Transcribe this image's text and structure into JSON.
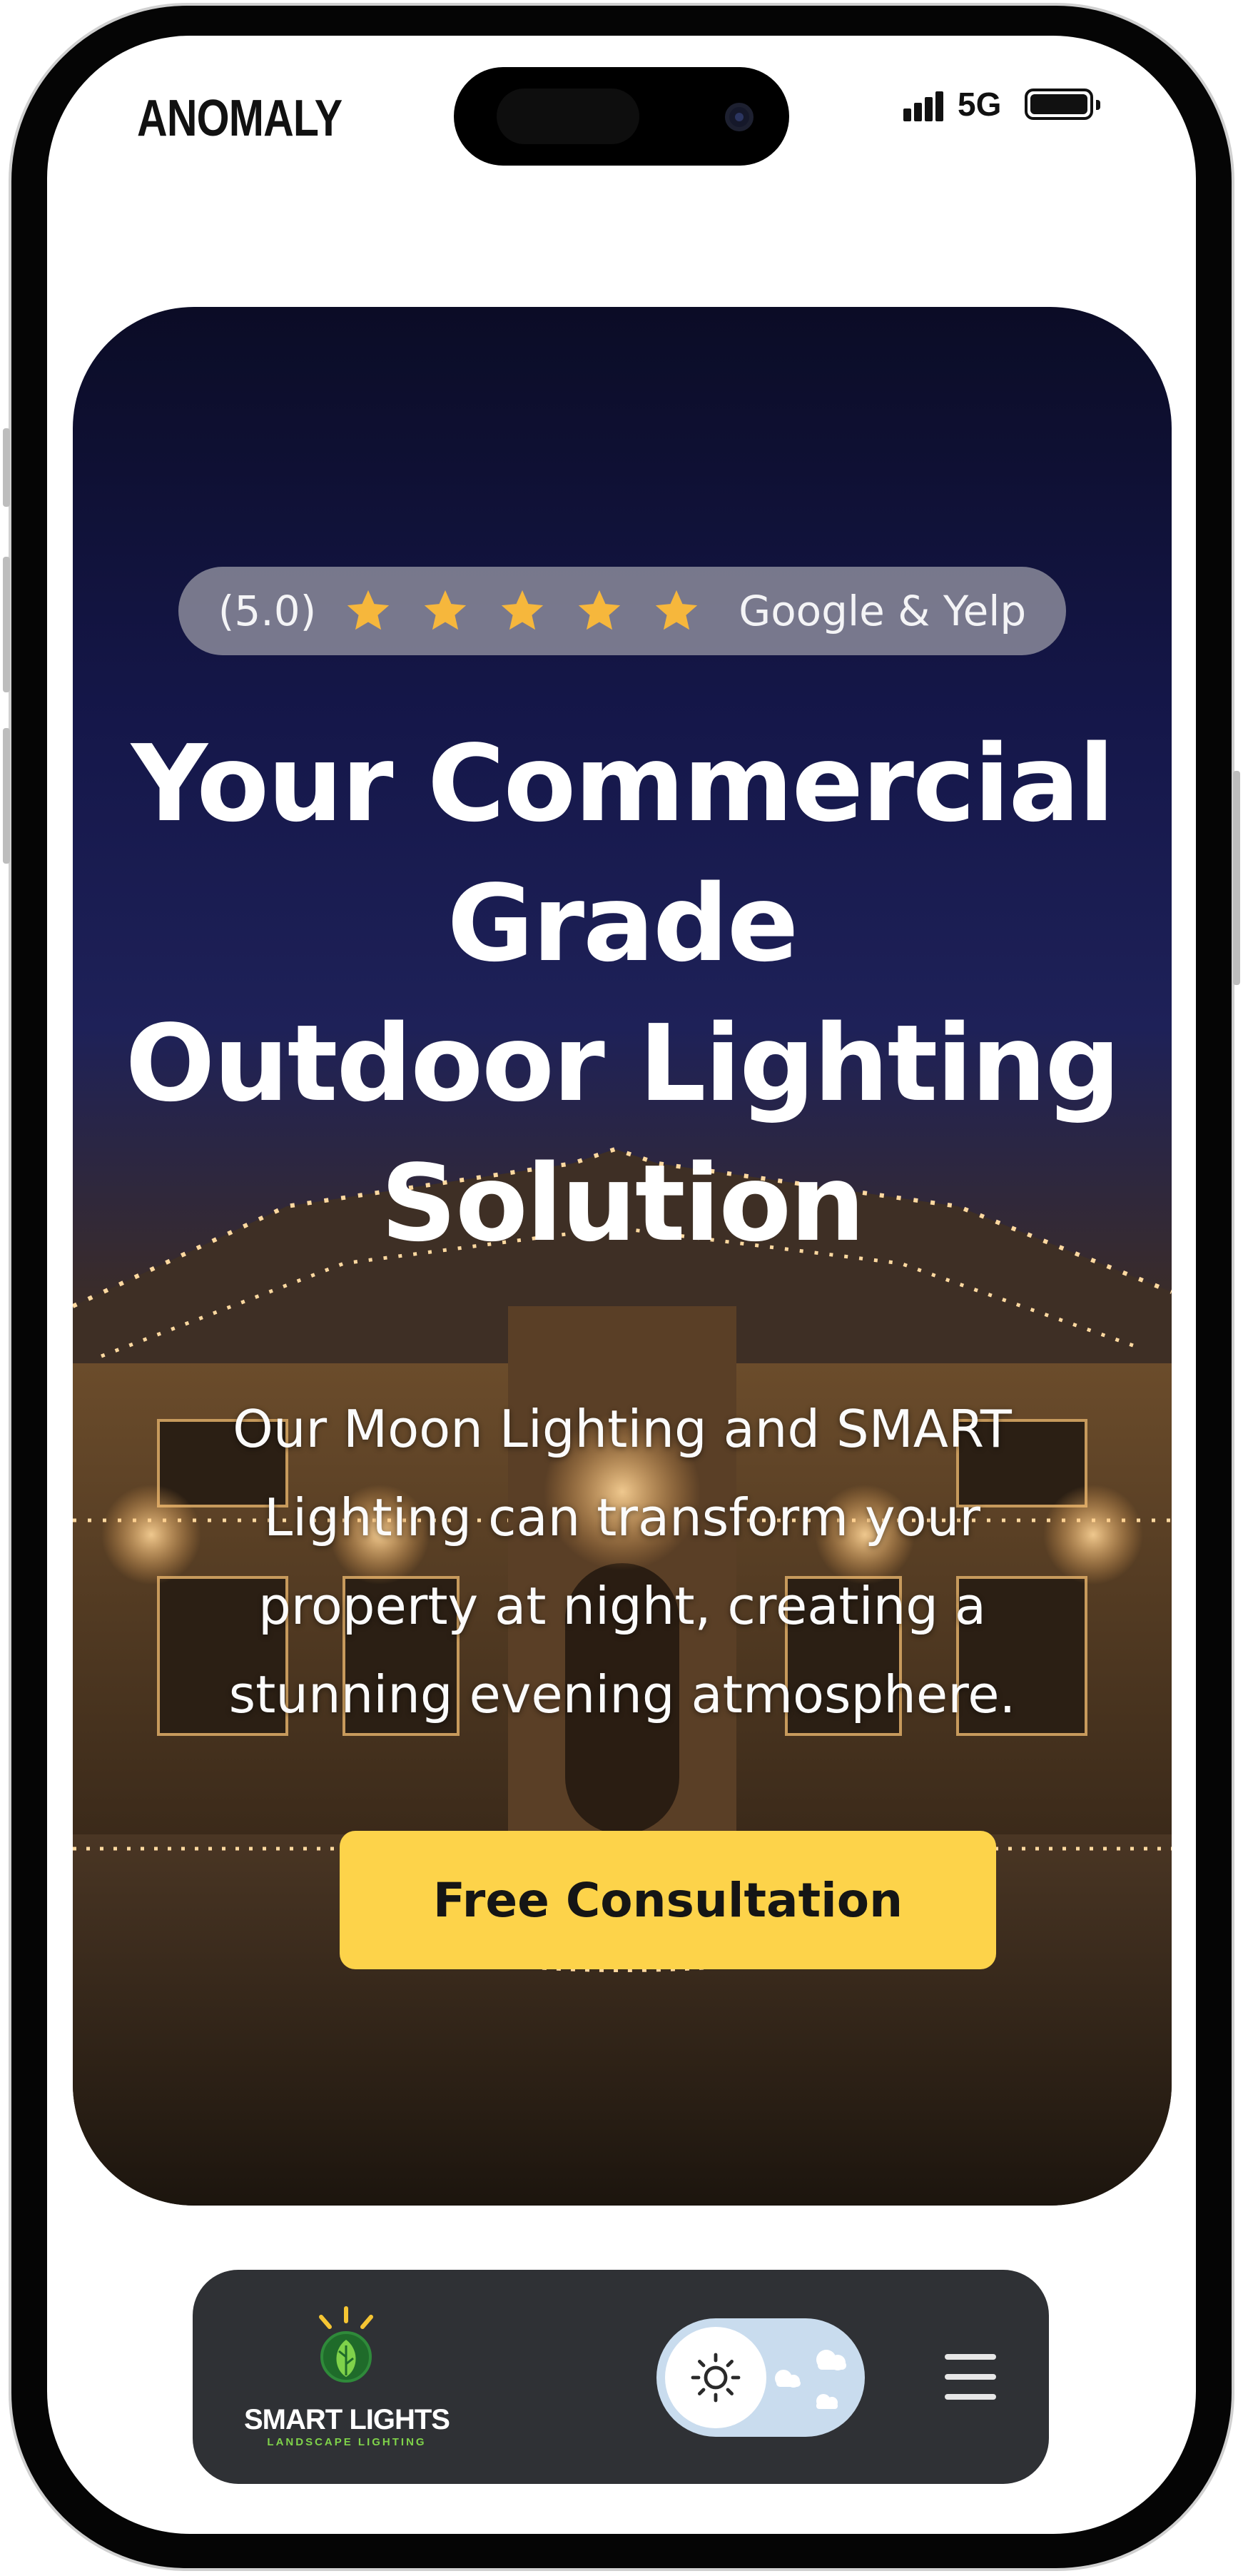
{
  "status_bar": {
    "brand": "ANOMALY",
    "network": "5G",
    "signal_bars": 4,
    "battery_level": 1.0
  },
  "hero": {
    "rating": {
      "score": "(5.0)",
      "stars": 5,
      "source": "Google & Yelp",
      "star_color": "#f6b73c"
    },
    "headline": [
      "Your Commercial",
      "Grade",
      "Outdoor Lighting",
      "Solution"
    ],
    "subtext": "Our Moon Lighting and SMART Lighting can transform your property at night, creating a stunning evening atmosphere.",
    "cta_label": "Free Consultation",
    "cta_color": "#fdd34a"
  },
  "bottom_nav": {
    "logo_text": "SMART LIGHTS",
    "logo_subtext": "LANDSCAPE LIGHTING",
    "theme_toggle_state": "light",
    "menu_icon": "hamburger-icon"
  }
}
